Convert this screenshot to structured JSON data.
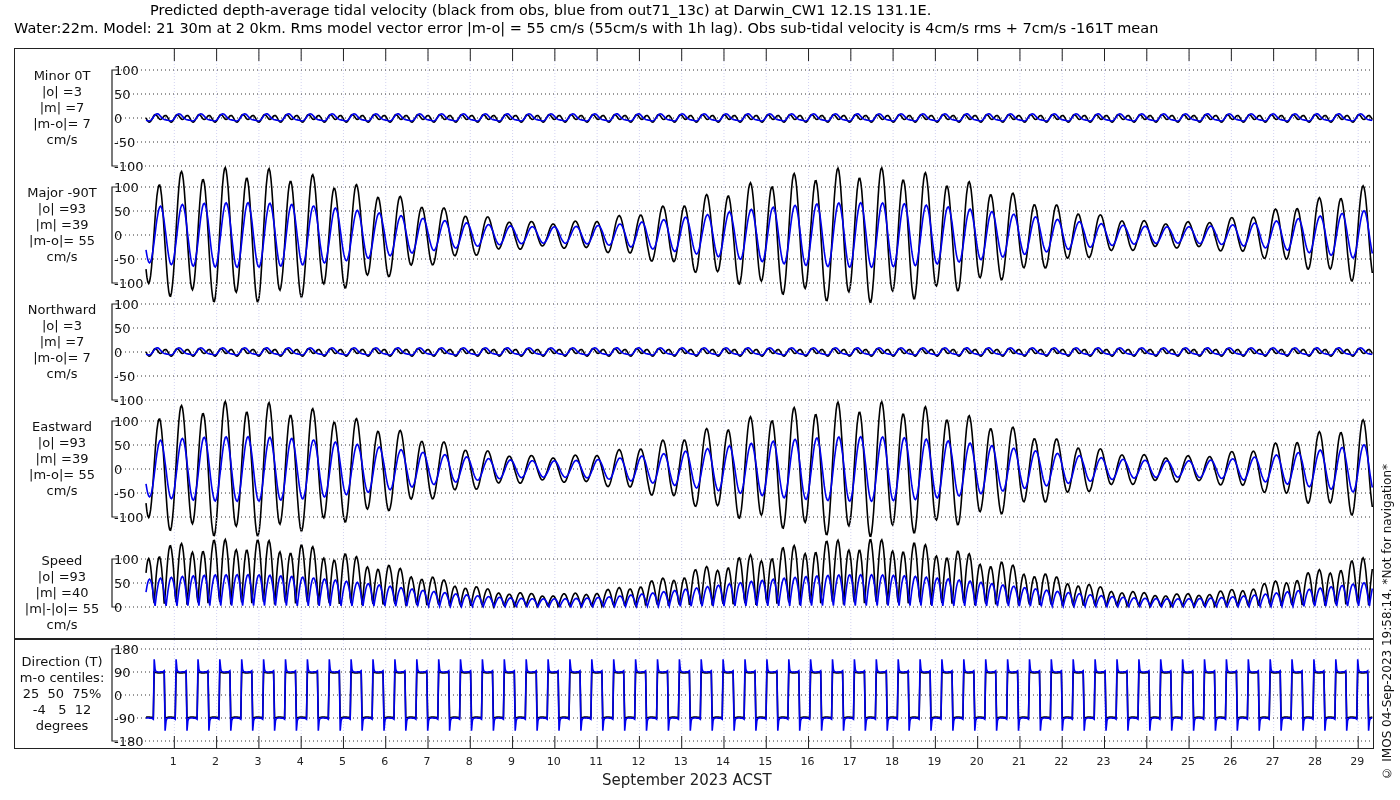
{
  "title": [
    "Predicted depth-average tidal velocity (black from obs, blue from out71_13c) at Darwin_CW1 12.1S 131.1E.",
    "Water:22m. Model: 21 30m at 2 0km. Rms model vector error |m-o| = 55 cm/s (55cm/s with 1h lag). Obs sub-tidal velocity is 4cm/s rms + 7cm/s -161T mean"
  ],
  "panels": [
    {
      "kind": "cross",
      "label": [
        "Minor 0T",
        "|o| =3",
        "|m| =7",
        "|m-o|= 7",
        "cm/s"
      ],
      "yticks": [
        "100",
        "50",
        "0",
        "-50",
        "-100"
      ]
    },
    {
      "kind": "along",
      "label": [
        "Major -90T",
        "|o| =93",
        "|m| =39",
        "|m-o|= 55",
        "cm/s"
      ],
      "yticks": [
        "100",
        "50",
        "0",
        "-50",
        "-100"
      ]
    },
    {
      "kind": "cross",
      "label": [
        "Northward",
        "|o| =3",
        "|m| =7",
        "|m-o|= 7",
        "cm/s"
      ],
      "yticks": [
        "100",
        "50",
        "0",
        "-50",
        "-100"
      ]
    },
    {
      "kind": "along",
      "label": [
        "Eastward",
        "|o| =93",
        "|m| =39",
        "|m-o|= 55",
        "cm/s"
      ],
      "yticks": [
        "100",
        "50",
        "0",
        "-50",
        "-100"
      ]
    },
    {
      "kind": "speed",
      "label": [
        "Speed",
        "|o| =93",
        "|m| =40",
        "|m|-|o|= 55",
        "cm/s"
      ],
      "yticks": [
        "100",
        "50",
        "0"
      ]
    }
  ],
  "direction_panel": {
    "kind": "direction",
    "label": [
      "Direction (T)",
      "m-o centiles:",
      "25  50  75%",
      "-4   5  12",
      "degrees"
    ],
    "yticks": [
      "180",
      "90",
      "0",
      "-90",
      "-180"
    ]
  },
  "xticks": [
    "1",
    "2",
    "3",
    "4",
    "5",
    "6",
    "7",
    "8",
    "9",
    "10",
    "11",
    "12",
    "13",
    "14",
    "15",
    "16",
    "17",
    "18",
    "19",
    "20",
    "21",
    "22",
    "23",
    "24",
    "25",
    "26",
    "27",
    "28",
    "29"
  ],
  "xlabel": "September 2023 ACST",
  "credit": "© IMOS 04-Sep-2023 19:58:14. *Not for navigation*"
}
